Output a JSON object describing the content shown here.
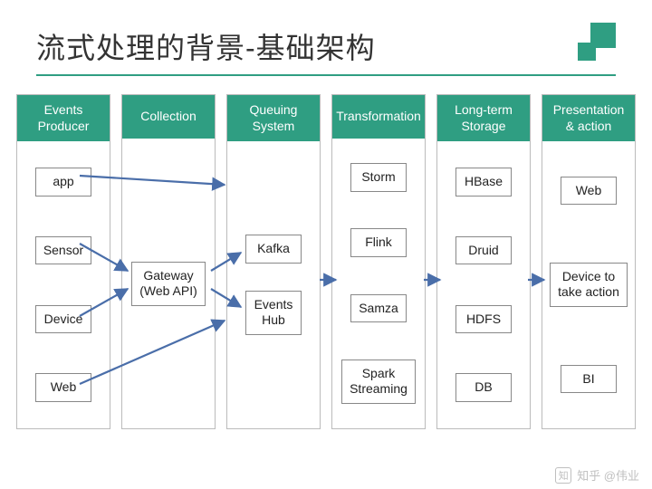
{
  "title": "流式处理的背景-基础架构",
  "watermark": "知乎 @伟业",
  "columns": [
    {
      "header": "Events\nProducer",
      "items": [
        "app",
        "Sensor",
        "Device",
        "Web"
      ]
    },
    {
      "header": "Collection",
      "items": [
        "Gateway\n(Web API)"
      ]
    },
    {
      "header": "Queuing\nSystem",
      "items": [
        "Kafka",
        "Events\nHub"
      ]
    },
    {
      "header": "Transformation",
      "items": [
        "Storm",
        "Flink",
        "Samza",
        "Spark\nStreaming"
      ]
    },
    {
      "header": "Long-term\nStorage",
      "items": [
        "HBase",
        "Druid",
        "HDFS",
        "DB"
      ]
    },
    {
      "header": "Presentation\n& action",
      "items": [
        "Web",
        "Device to\ntake action",
        "BI"
      ]
    }
  ],
  "arrows": [
    {
      "from": "app",
      "to": "Queuing System (column)"
    },
    {
      "from": "Sensor",
      "to": "Gateway (Web API)"
    },
    {
      "from": "Device",
      "to": "Gateway (Web API)"
    },
    {
      "from": "Web",
      "to": "Queuing System (column)"
    },
    {
      "from": "Gateway (Web API)",
      "to": "Kafka"
    },
    {
      "from": "Gateway (Web API)",
      "to": "Events Hub"
    },
    {
      "from": "Queuing System",
      "to": "Transformation"
    },
    {
      "from": "Transformation",
      "to": "Long-term Storage"
    },
    {
      "from": "Long-term Storage",
      "to": "Presentation & action"
    }
  ]
}
